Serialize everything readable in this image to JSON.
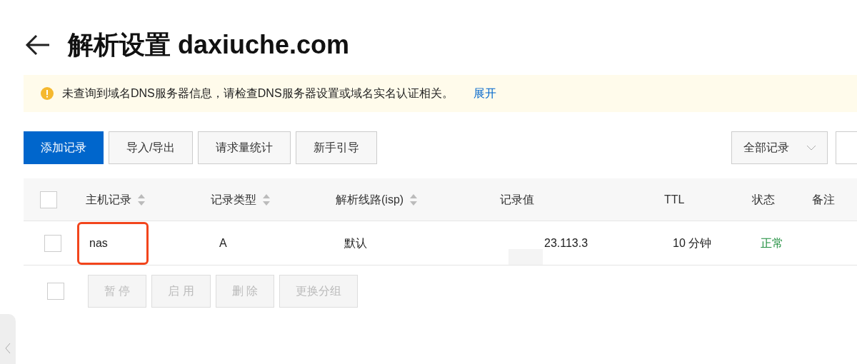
{
  "title": "解析设置 daxiuche.com",
  "notice": {
    "message": "未查询到域名DNS服务器信息，请检查DNS服务器设置或域名实名认证相关。",
    "link": "展开"
  },
  "toolbar": [
    {
      "label": "添加记录",
      "kind": "primary"
    },
    {
      "label": "导入/导出",
      "kind": "default"
    },
    {
      "label": "请求量统计",
      "kind": "default"
    },
    {
      "label": "新手引导",
      "kind": "default"
    }
  ],
  "filter": {
    "value": "全部记录"
  },
  "table": {
    "columns": [
      {
        "label": "主机记录",
        "sortable": true
      },
      {
        "label": "记录类型",
        "sortable": true
      },
      {
        "label": "解析线路(isp)",
        "sortable": true
      },
      {
        "label": "记录值",
        "sortable": false
      },
      {
        "label": "TTL",
        "sortable": false
      },
      {
        "label": "状态",
        "sortable": false
      },
      {
        "label": "备注",
        "sortable": false
      }
    ],
    "header_checked": false,
    "rows": [
      {
        "checked": false,
        "highlighted": true,
        "cells": [
          "nas",
          "A",
          "默认",
          "23.113.3",
          "10 分钟",
          "正常"
        ],
        "status_ok": true
      }
    ]
  },
  "bulk_actions": {
    "checked": false,
    "buttons": [
      {
        "label": "暂 停",
        "disabled": true
      },
      {
        "label": "启 用",
        "disabled": true
      },
      {
        "label": "删 除",
        "disabled": true
      },
      {
        "label": "更换分组",
        "disabled": true
      }
    ]
  }
}
